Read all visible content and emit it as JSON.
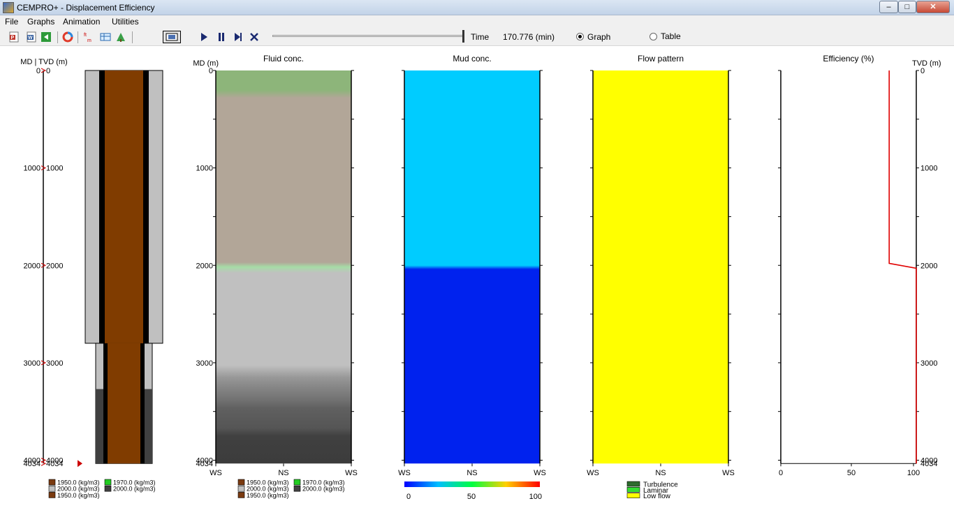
{
  "window": {
    "title": "CEMPRO+ - Displacement Efficiency",
    "min_symbol": "–",
    "max_symbol": "□",
    "close_symbol": "✕"
  },
  "menu": [
    "File",
    "Graphs",
    "Animation",
    "Utilities"
  ],
  "toolbar": {
    "time_label": "Time",
    "time_value": "170.776 (min)",
    "slider_position": 1.0,
    "graph_label": "Graph",
    "table_label": "Table",
    "view_mode": "Graph",
    "icons": [
      "pdf-export-icon",
      "word-export-icon",
      "back-icon",
      "chart-ring-icon",
      "ft-to-m-icon",
      "table-icon",
      "tree-icon",
      "screenshot-icon",
      "play-icon",
      "pause-icon",
      "step-icon",
      "stop-icon"
    ]
  },
  "wellbore": {
    "axis_label": "MD | TVD (m)",
    "ticks": [
      "0",
      "1000",
      "2000",
      "3000",
      "4000"
    ],
    "tick_pairs": [
      [
        "0",
        "0"
      ],
      [
        "1000",
        "1000"
      ],
      [
        "2000",
        "2000"
      ],
      [
        "3000",
        "3000"
      ],
      [
        "4000",
        "4000"
      ],
      [
        "4034",
        "4034"
      ]
    ],
    "colors": {
      "mud_inner": "#803c00",
      "pipe": "#000000",
      "annulus_light": "#c0c0c0",
      "annulus_dark": "#404040"
    },
    "legend": [
      {
        "label": "1950.0 (kg/m3)",
        "color": "#7a3a10"
      },
      {
        "label": "1970.0 (kg/m3)",
        "color": "#22cc22"
      },
      {
        "label": "2000.0 (kg/m3)",
        "color": "#c0c0c0"
      },
      {
        "label": "2000.0 (kg/m3)",
        "color": "#404040"
      },
      {
        "label": "1950.0 (kg/m3)",
        "color": "#7a3a10"
      }
    ]
  },
  "panels": {
    "fluid": {
      "title": "Fluid conc.",
      "axis_label": "MD (m)",
      "ticks": [
        "0",
        "1000",
        "2000",
        "3000",
        "4000"
      ],
      "x_labels": [
        "WS",
        "NS",
        "WS"
      ]
    },
    "mud": {
      "title": "Mud conc.",
      "x_labels": [
        "WS",
        "NS",
        "WS"
      ],
      "colorbar_labels": [
        "0",
        "50",
        "100"
      ],
      "colors": {
        "upper": "#00ccff",
        "lower": "#0022ee"
      }
    },
    "flow": {
      "title": "Flow pattern",
      "x_labels": [
        "WS",
        "NS",
        "WS"
      ],
      "color": "#ffff00",
      "legend": [
        {
          "label": "Turbulence",
          "color": "#2e6b2e"
        },
        {
          "label": "Laminar",
          "color": "#33dd33"
        },
        {
          "label": "Low flow",
          "color": "#ffff00"
        }
      ]
    },
    "efficiency": {
      "title": "Efficiency (%)",
      "axis_label": "TVD (m)",
      "ticks": [
        "0",
        "1000",
        "2000",
        "3000",
        "4000"
      ],
      "bottom_ticks": [
        "4034"
      ],
      "x_labels": [
        "0",
        "50",
        "100"
      ],
      "curve": [
        {
          "md": 0,
          "eff": 80
        },
        {
          "md": 1980,
          "eff": 80
        },
        {
          "md": 2030,
          "eff": 100
        },
        {
          "md": 4034,
          "eff": 100
        }
      ]
    }
  },
  "fluid_legend": [
    {
      "label": "1950.0 (kg/m3)",
      "color": "#7a3a10"
    },
    {
      "label": "1970.0 (kg/m3)",
      "color": "#22cc22"
    },
    {
      "label": "2000.0 (kg/m3)",
      "color": "#c0c0c0"
    },
    {
      "label": "2000.0 (kg/m3)",
      "color": "#404040"
    },
    {
      "label": "1950.0 (kg/m3)",
      "color": "#7a3a10"
    }
  ]
}
